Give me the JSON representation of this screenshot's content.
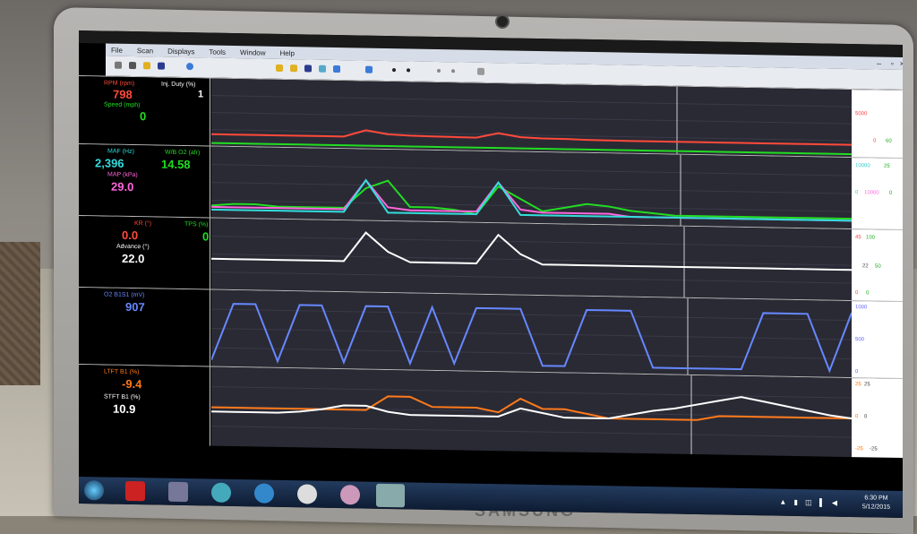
{
  "menu": [
    "File",
    "Scan",
    "Displays",
    "Tools",
    "Window",
    "Help"
  ],
  "panels": [
    {
      "id": "rpm",
      "labels": [
        {
          "name": "RPM (rpm)",
          "value": "798",
          "color": "#ff4a3a"
        },
        {
          "name": "Inj. Duty (%)",
          "value": "1",
          "color": "#ffffff"
        },
        {
          "name": "Speed (mph)",
          "value": "0",
          "color": "#22dd22"
        }
      ],
      "scale": [
        "5000",
        "0",
        "60"
      ]
    },
    {
      "id": "maf",
      "labels": [
        {
          "name": "MAF (Hz)",
          "value": "2,396",
          "color": "#33dddd"
        },
        {
          "name": "W/B O2 (afr)",
          "value": "14.58",
          "color": "#22dd22"
        },
        {
          "name": "MAP (kPa)",
          "value": "29.0",
          "color": "#ff66dd"
        }
      ],
      "scale": [
        "10000",
        "25",
        "0",
        "10000",
        "0"
      ]
    },
    {
      "id": "knock",
      "labels": [
        {
          "name": "KR (°)",
          "value": "0.0",
          "color": "#ff4a3a"
        },
        {
          "name": "TPS (%)",
          "value": "0",
          "color": "#22dd22"
        },
        {
          "name": "Advance (°)",
          "value": "22.0",
          "color": "#ffffff"
        }
      ],
      "scale": [
        "45",
        "100",
        "22",
        "50",
        "0",
        "0"
      ]
    },
    {
      "id": "o2",
      "labels": [
        {
          "name": "O2 B1S1 (mV)",
          "value": "907",
          "color": "#6688ff"
        }
      ],
      "scale": [
        "1000",
        "500",
        "0"
      ]
    },
    {
      "id": "trim",
      "labels": [
        {
          "name": "LTFT B1 (%)",
          "value": "-9.4",
          "color": "#ff7a1a"
        },
        {
          "name": "STFT B1 (%)",
          "value": "10.9",
          "color": "#ffffff"
        }
      ],
      "scale": [
        "25",
        "25",
        "0",
        "0",
        "-25",
        "-25"
      ]
    }
  ],
  "clock": {
    "time": "6:30 PM",
    "date": "5/12/2015"
  },
  "brand": "SAMSUNG",
  "chart_data": [
    {
      "type": "line",
      "title": "",
      "series": [
        {
          "name": "RPM (rpm)",
          "color": "#ff4a3a",
          "values": [
            740,
            740,
            740,
            740,
            740,
            740,
            740,
            1300,
            1000,
            920,
            880,
            860,
            840,
            1250,
            950,
            880,
            860,
            820,
            800,
            790,
            790,
            790,
            790,
            790,
            790,
            790,
            790,
            790,
            790,
            790
          ]
        },
        {
          "name": "Speed (mph)",
          "color": "#22dd22",
          "values": [
            0,
            0,
            0,
            0,
            0,
            0,
            0,
            0,
            0,
            0,
            0,
            0,
            0,
            0,
            0,
            0,
            0,
            0,
            0,
            0,
            0,
            0,
            0,
            0,
            0,
            0,
            0,
            0,
            0,
            0
          ]
        }
      ],
      "ylim": [
        0,
        5000
      ]
    },
    {
      "type": "line",
      "series": [
        {
          "name": "W/B O2 (afr)",
          "color": "#22dd22",
          "values": [
            14.6,
            14.7,
            14.7,
            14.6,
            14.6,
            14.6,
            14.6,
            15.6,
            16,
            14.7,
            14.7,
            14.6,
            14.4,
            15.8,
            15.2,
            14.6,
            14.8,
            15,
            14.9,
            14.7,
            14.6,
            14.5,
            14.5,
            14.5,
            14.5,
            14.5,
            14.5,
            14.5,
            14.5,
            14.5
          ]
        },
        {
          "name": "MAP (kPa)",
          "color": "#ff66dd",
          "values": [
            29,
            29,
            29,
            29,
            29,
            29,
            29,
            40,
            30,
            29,
            29,
            29,
            29,
            40,
            30,
            29,
            29,
            29,
            29,
            28,
            28,
            28,
            28,
            28,
            28,
            28,
            28,
            28,
            28,
            28
          ]
        },
        {
          "name": "MAF (Hz)",
          "color": "#33dddd",
          "values": [
            2400,
            2400,
            2400,
            2400,
            2400,
            2400,
            2400,
            2700,
            2400,
            2400,
            2400,
            2400,
            2400,
            2700,
            2400,
            2400,
            2400,
            2400,
            2400,
            2400,
            2400,
            2400,
            2400,
            2400,
            2400,
            2400,
            2400,
            2400,
            2400,
            2400
          ]
        }
      ]
    },
    {
      "type": "line",
      "series": [
        {
          "name": "Advance (°)",
          "color": "#ffffff",
          "values": [
            22,
            22,
            22,
            22,
            22,
            22,
            22,
            45,
            30,
            22,
            22,
            22,
            22,
            45,
            30,
            22,
            22,
            22,
            22,
            22,
            22,
            22,
            22,
            22,
            22,
            22,
            22,
            22,
            22,
            22
          ]
        }
      ],
      "ylim": [
        0,
        50
      ]
    },
    {
      "type": "line",
      "series": [
        {
          "name": "O2 B1S1 (mV)",
          "color": "#6688ff",
          "values": [
            50,
            880,
            880,
            50,
            880,
            880,
            50,
            880,
            880,
            50,
            880,
            60,
            880,
            880,
            880,
            50,
            50,
            880,
            880,
            880,
            50,
            50,
            50,
            50,
            50,
            880,
            880,
            880,
            50,
            907
          ]
        }
      ],
      "ylim": [
        0,
        1000
      ]
    },
    {
      "type": "line",
      "series": [
        {
          "name": "LTFT B1 (%)",
          "color": "#ff7a1a",
          "values": [
            0,
            0,
            0,
            0,
            0,
            0,
            0,
            0,
            10,
            10,
            3,
            3,
            3,
            0,
            10,
            3,
            3,
            0,
            -3,
            -3,
            -3,
            -3,
            -3,
            0,
            0,
            0,
            0,
            0,
            0,
            0
          ]
        },
        {
          "name": "STFT B1 (%)",
          "color": "#ffffff",
          "values": [
            -3,
            -3,
            -3,
            -3,
            -2,
            0,
            3,
            3,
            -1,
            -3,
            -3,
            -3,
            -3,
            -3,
            3,
            0,
            -3,
            -3,
            -3,
            0,
            3,
            5,
            8,
            11,
            14,
            11,
            8,
            5,
            2,
            0
          ]
        }
      ],
      "ylim": [
        -25,
        25
      ]
    }
  ]
}
